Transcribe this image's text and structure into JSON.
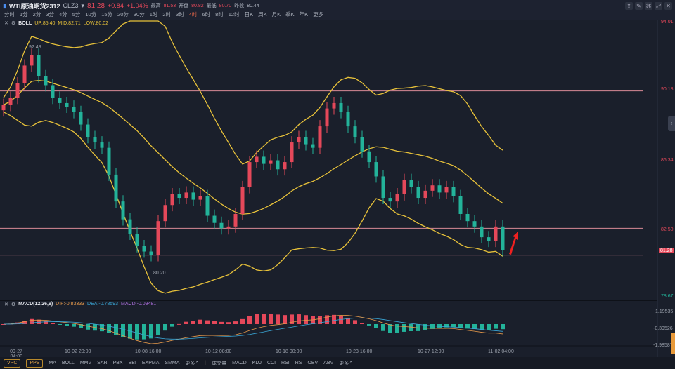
{
  "header": {
    "title": "WTI原油期货2312",
    "code": "CLZ3",
    "price": "81.28",
    "change": "+0.84",
    "change_pct": "+1.04%",
    "high_label": "最高",
    "high": "81.53",
    "open_label": "开盘",
    "open": "80.82",
    "low_label": "最低",
    "low": "80.70",
    "prev_label": "昨收",
    "prev": "80.44"
  },
  "periods": [
    "分时",
    "1分",
    "2分",
    "3分",
    "4分",
    "5分",
    "10分",
    "15分",
    "20分",
    "30分",
    "1时",
    "2时",
    "3时",
    "4时",
    "6时",
    "8时",
    "12时",
    "日K",
    "周K",
    "月K",
    "季K",
    "年K",
    "更多"
  ],
  "active_period": "4时",
  "toolbar_icons": [
    "draw-icon",
    "pen-icon",
    "magnet-icon",
    "expand-icon",
    "fullscreen-icon"
  ],
  "boll": {
    "name": "BOLL",
    "up": "UP:85.40",
    "mid": "MID:82.71",
    "low": "LOW:80.02"
  },
  "macd": {
    "name": "MACD(12,26,9)",
    "dif": "DIF:-0.83333",
    "dea": "DEA:-0.78593",
    "macd": "MACD:-0.09481"
  },
  "price_axis": [
    "94.01",
    "90.18",
    "86.34",
    "82.50",
    "78.67"
  ],
  "current_price_tag": "81.28",
  "macd_axis": [
    "1.19535",
    "-0.39526",
    "-1.98587"
  ],
  "annotations": {
    "high": "92.48",
    "low": "80.20"
  },
  "x_axis": [
    "09-27 04:00",
    "10-02 20:00",
    "10-08 16:00",
    "10-12 08:00",
    "10-18 00:00",
    "10-23 16:00",
    "10-27 12:00",
    "11-02 04:00"
  ],
  "bottom": {
    "buttons": [
      "VPC",
      "PPS"
    ],
    "main_ind": [
      "MA",
      "BOLL",
      "MMV",
      "SAR",
      "PBX",
      "BBI",
      "EXPMA",
      "SMMA",
      "更多⌃"
    ],
    "sub_ind": [
      "成交量",
      "MACD",
      "KDJ",
      "CCI",
      "RSI",
      "RS",
      "OBV",
      "ABV",
      "更多⌃"
    ]
  },
  "colors": {
    "up": "#e5485a",
    "down": "#23b39a",
    "boll": "#e8c23a",
    "bg": "#1a1f2b"
  },
  "chart_data": {
    "type": "candlestick",
    "ylim": [
      78.67,
      94.01
    ],
    "horizontal_lines": [
      90.18,
      82.5,
      81.0
    ],
    "closes": [
      89.4,
      89.8,
      90.6,
      91.6,
      92.2,
      91.0,
      90.5,
      89.8,
      89.5,
      89.3,
      89.0,
      88.3,
      87.6,
      87.3,
      87.0,
      85.5,
      84.0,
      83.0,
      82.2,
      81.5,
      81.2,
      81.0,
      82.9,
      83.8,
      84.4,
      84.2,
      84.5,
      84.1,
      84.3,
      83.2,
      82.8,
      82.5,
      82.6,
      83.3,
      84.8,
      86.2,
      86.5,
      86.1,
      86.3,
      85.8,
      86.2,
      87.3,
      87.6,
      87.2,
      87.0,
      88.2,
      89.2,
      89.5,
      89.0,
      88.2,
      87.6,
      86.8,
      86.2,
      85.4,
      84.2,
      84.0,
      84.4,
      85.2,
      84.8,
      84.2,
      84.6,
      84.9,
      84.5,
      84.8,
      84.3,
      83.3,
      82.9,
      82.6,
      82.0,
      81.8,
      82.6,
      81.28
    ]
  }
}
